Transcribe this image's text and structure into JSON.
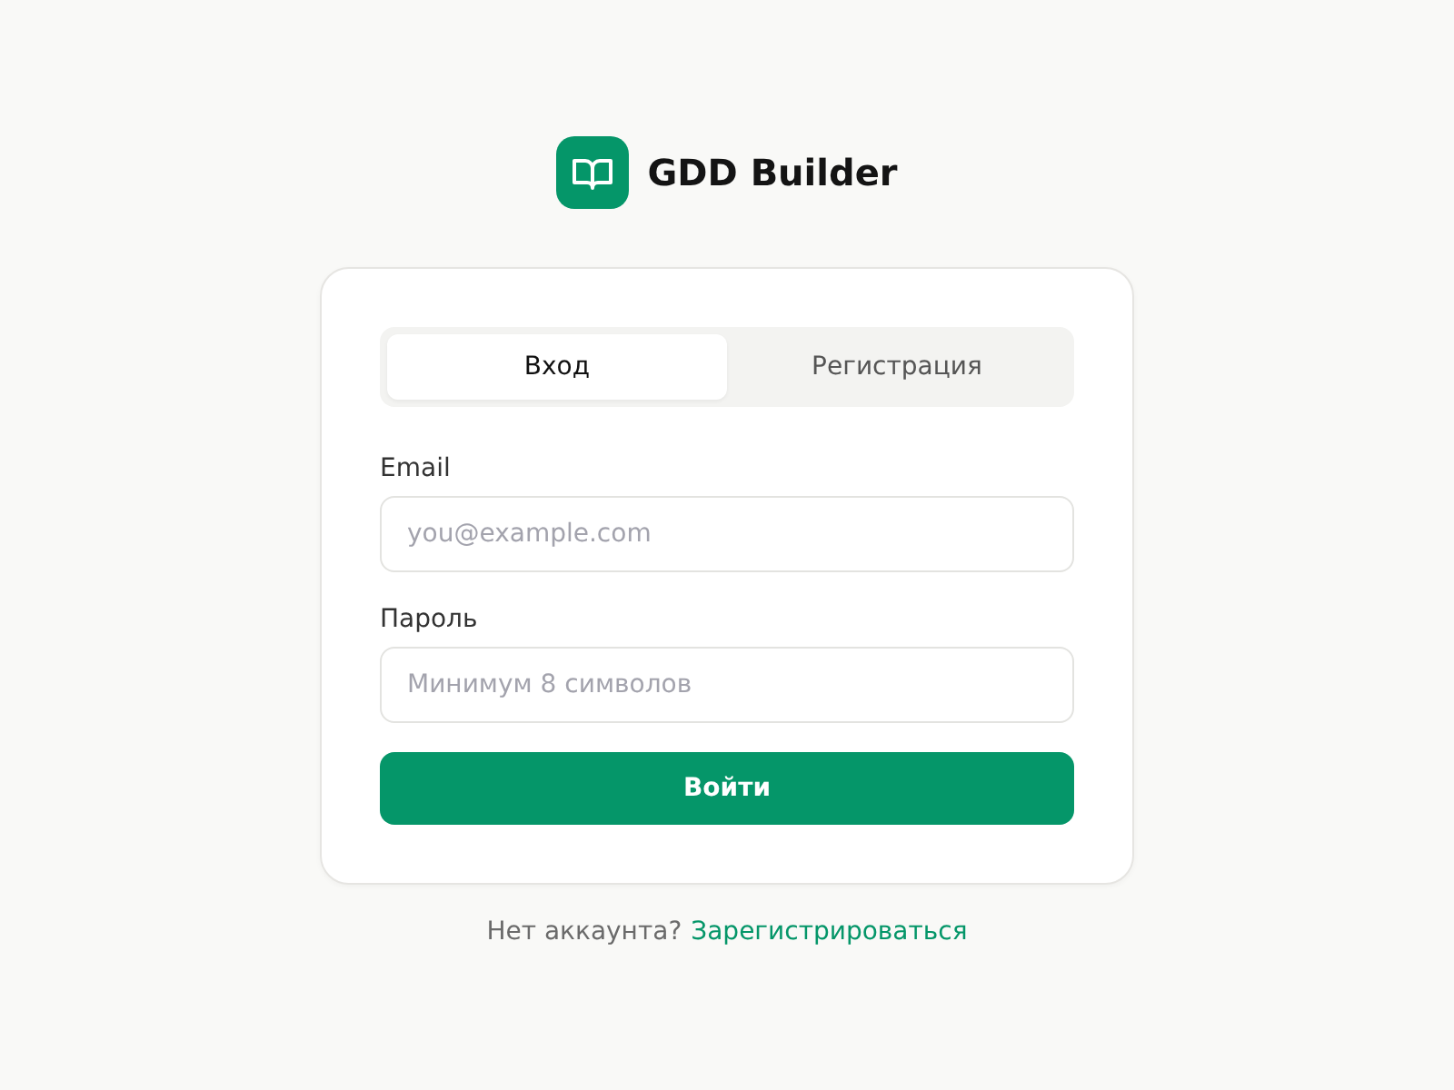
{
  "app": {
    "title": "GDD Builder"
  },
  "tabs": [
    {
      "label": "Вход",
      "selected": true
    },
    {
      "label": "Регистрация",
      "selected": false
    }
  ],
  "fields": [
    {
      "label": "Email",
      "placeholder": "you@example.com"
    },
    {
      "label": "Пароль",
      "placeholder": "Минимум 8 символов"
    }
  ],
  "submit_button": "Войти",
  "footer": {
    "text": "Нет аккаунта?",
    "link": "Зарегистрироваться"
  }
}
